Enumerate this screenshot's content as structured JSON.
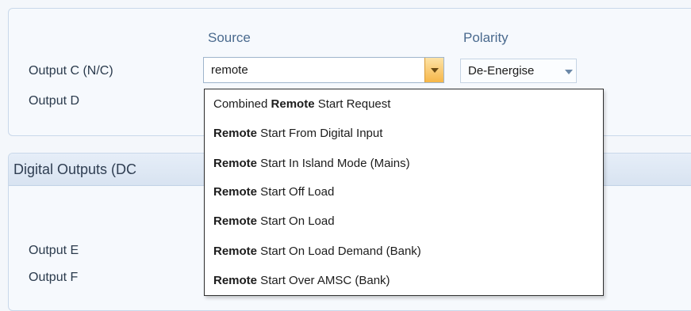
{
  "columns": {
    "source": "Source",
    "polarity": "Polarity"
  },
  "outputs_top": {
    "c": "Output C (N/C)",
    "d": "Output D"
  },
  "source_field": {
    "value": "remote"
  },
  "polarity_field": {
    "value": "De-Energise"
  },
  "digital_section": {
    "title": "Digital Outputs (DC "
  },
  "outputs_bottom": {
    "e": "Output E",
    "f": "Output F"
  },
  "dropdown_items": [
    {
      "pre": "Combined ",
      "match": "Remote",
      "post": " Start Request"
    },
    {
      "pre": "",
      "match": "Remote",
      "post": " Start From Digital Input"
    },
    {
      "pre": "",
      "match": "Remote",
      "post": " Start In Island Mode (Mains)"
    },
    {
      "pre": "",
      "match": "Remote",
      "post": " Start Off Load"
    },
    {
      "pre": "",
      "match": "Remote",
      "post": " Start On Load"
    },
    {
      "pre": "",
      "match": "Remote",
      "post": " Start On Load Demand (Bank)"
    },
    {
      "pre": "",
      "match": "Remote",
      "post": " Start Over AMSC (Bank)"
    }
  ],
  "colors": {
    "accent_dropdown_button": "#f6b648",
    "header_text": "#4a6a8e"
  }
}
